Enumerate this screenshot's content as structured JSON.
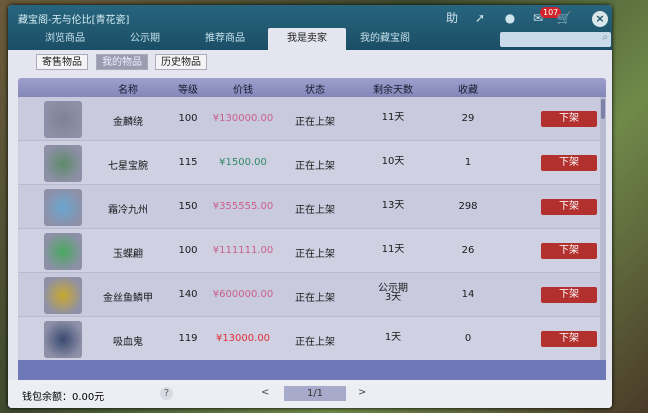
{
  "window": {
    "title": "藏宝阁-无与伦比[青花瓷]",
    "notification_count": "107"
  },
  "tabs": [
    "浏览商品",
    "公示期",
    "推荐商品",
    "我是卖家",
    "我的藏宝阁"
  ],
  "active_tab": 3,
  "search": {
    "placeholder": ""
  },
  "subtabs": [
    "寄售物品",
    "我的物品",
    "历史物品"
  ],
  "columns": [
    "名称",
    "等级",
    "价钱",
    "状态",
    "剩余天数",
    "收藏"
  ],
  "rows": [
    {
      "name": "金麟绕",
      "level": "100",
      "price": "¥130000.00",
      "status": "正在上架",
      "days": "11天",
      "fav": "29",
      "action": "下架",
      "price_color": "#c8608c",
      "icon_color": "#7e8296"
    },
    {
      "name": "七星宝腕",
      "level": "115",
      "price": "¥1500.00",
      "status": "正在上架",
      "days": "10天",
      "fav": "1",
      "action": "下架",
      "price_color": "#2f8a6a",
      "icon_color": "#5f8a6a"
    },
    {
      "name": "霜冷九州",
      "level": "150",
      "price": "¥355555.00",
      "status": "正在上架",
      "days": "13天",
      "fav": "298",
      "action": "下架",
      "price_color": "#c8608c",
      "icon_color": "#6aa6d0"
    },
    {
      "name": "玉蝶翩",
      "level": "100",
      "price": "¥111111.00",
      "status": "正在上架",
      "days": "11天",
      "fav": "26",
      "action": "下架",
      "price_color": "#c8608c",
      "icon_color": "#4aa860"
    },
    {
      "name": "金丝鱼鳞甲",
      "level": "140",
      "price": "¥600000.00",
      "status": "正在上架",
      "days": "公示期\n3天",
      "fav": "14",
      "action": "下架",
      "price_color": "#c8608c",
      "icon_color": "#c8a830"
    },
    {
      "name": "吸血鬼",
      "level": "119",
      "price": "¥13000.00",
      "status": "正在上架",
      "days": "1天",
      "fav": "0",
      "action": "下架",
      "price_color": "#e0303a",
      "icon_color": "#3a4a70"
    }
  ],
  "footer": {
    "wallet": "钱包余额：0.00元",
    "help": "?",
    "page": "1/1",
    "prev": "<",
    "next": ">"
  }
}
